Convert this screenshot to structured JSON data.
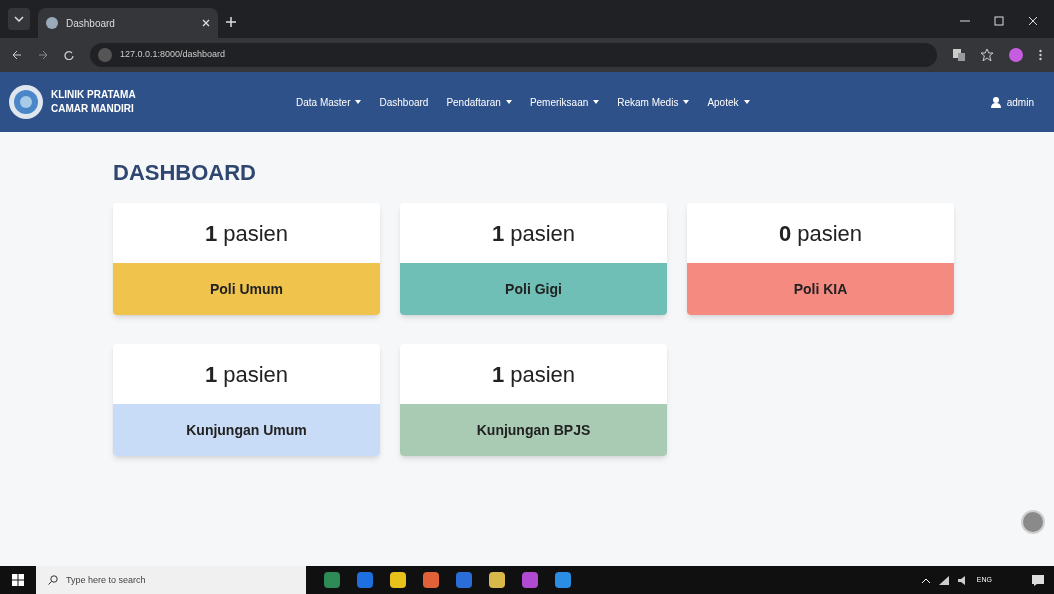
{
  "browser": {
    "tab_title": "Dashboard",
    "url": "127.0.0.1:8000/dashboard"
  },
  "navbar": {
    "brand_lines": [
      "KLINIK PRATAMA",
      "CAMAR MANDIRI"
    ],
    "items": [
      {
        "label": "Data Master",
        "dropdown": true
      },
      {
        "label": "Dashboard",
        "dropdown": false
      },
      {
        "label": "Pendaftaran",
        "dropdown": true
      },
      {
        "label": "Pemeriksaan",
        "dropdown": true
      },
      {
        "label": "Rekam Medis",
        "dropdown": true
      },
      {
        "label": "Apotek",
        "dropdown": true
      }
    ],
    "user": "admin"
  },
  "heading": "DASHBOARD",
  "cards": [
    {
      "count": "**1** pasien",
      "name": "Poli Umum",
      "color": "#f0c44c"
    },
    {
      "count": "**1** pasien",
      "name": "Poli Gigi",
      "color": "#6fbfb6"
    },
    {
      "count": "**0** pasien",
      "name": "Poli KIA",
      "color": "#f58a80"
    },
    {
      "count": "**1** pasien",
      "name": "Kunjungan Umum",
      "color": "#c9dcf7"
    },
    {
      "count": "**1** pasien",
      "name": "Kunjungan BPJS",
      "color": "#a9cbb4"
    }
  ],
  "taskbar": {
    "search_placeholder": "Type here to search",
    "language": "ENG"
  }
}
